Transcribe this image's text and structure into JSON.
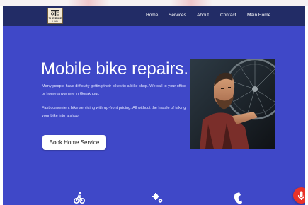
{
  "brand": {
    "logo_line1": "THE BIKE",
    "logo_line2": "HUB"
  },
  "nav": {
    "items": [
      {
        "label": "Home"
      },
      {
        "label": "Services"
      },
      {
        "label": "About"
      },
      {
        "label": "Contact"
      },
      {
        "label": "Main Home"
      }
    ]
  },
  "hero": {
    "title": "Mobile bike repairs.",
    "paragraph1": "Many people have difficulty getting their bikes to a bike shop. We call to your office or home anywhere in Gorakhpur.",
    "paragraph2": "Fast,convenient bike servicing with up-front pricing. All without the hassle of taking your bike into a shop",
    "cta_label": "Book Home Service"
  },
  "features": {
    "icons": [
      "bicycle-icon",
      "gears-icon",
      "phone-icon"
    ]
  },
  "floating_button": {
    "icon": "microphone-icon"
  },
  "colors": {
    "hero_background": "#3f48c8",
    "navbar_background": "#222c66",
    "cta_background": "#ffffff",
    "fab_background": "#e8332a"
  }
}
